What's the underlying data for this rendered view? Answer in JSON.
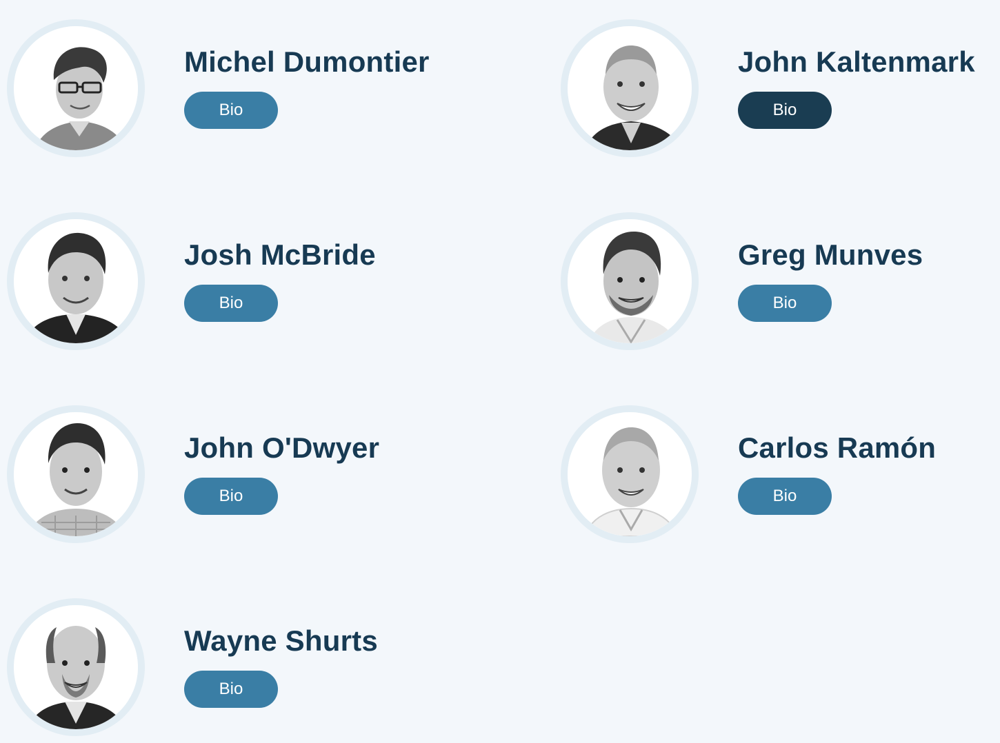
{
  "page": {
    "background": "#f3f7fb"
  },
  "colors": {
    "name_text": "#173a53",
    "bio_button": "#3a7ea5",
    "bio_button_active": "#1a3d52",
    "avatar_ring": "#e2edf4"
  },
  "people": [
    {
      "name": "Michel Dumontier",
      "bio_label": "Bio",
      "photo": "portrait-glasses",
      "active": false
    },
    {
      "name": "John Kaltenmark",
      "bio_label": "Bio",
      "photo": "portrait-bald-smiling",
      "active": true
    },
    {
      "name": "Josh McBride",
      "bio_label": "Bio",
      "photo": "portrait-short-hair-suit",
      "active": false
    },
    {
      "name": "Greg Munves",
      "bio_label": "Bio",
      "photo": "portrait-slicked-hair-stubble",
      "active": false
    },
    {
      "name": "John O'Dwyer",
      "bio_label": "Bio",
      "photo": "portrait-short-hair-checked-shirt",
      "active": false
    },
    {
      "name": "Carlos Ramón",
      "bio_label": "Bio",
      "photo": "portrait-bald-open-collar",
      "active": false
    },
    {
      "name": "Wayne Shurts",
      "bio_label": "Bio",
      "photo": "portrait-balding-suit",
      "active": false
    }
  ]
}
